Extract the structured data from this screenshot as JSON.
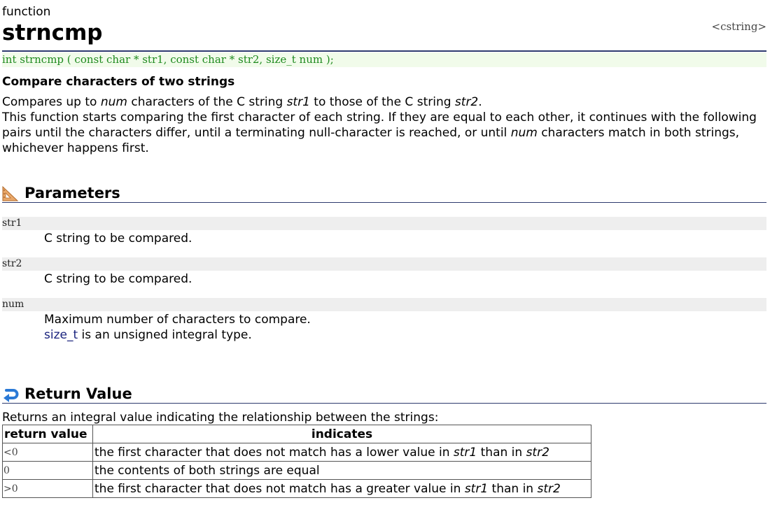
{
  "doc": {
    "kind": "function",
    "title": "strncmp",
    "header_tag": "<cstring>",
    "prototype": "int strncmp ( const char * str1, const char * str2, size_t num );",
    "subtitle": "Compare characters of two strings",
    "description": {
      "p1": {
        "a": "Compares up to ",
        "num": "num",
        "b": " characters of the C string ",
        "str1": "str1",
        "c": " to those of the C string ",
        "str2": "str2",
        "d": "."
      },
      "p2": {
        "a": "This function starts comparing the first character of each string. If they are equal to each other, it continues with the following pairs until the characters differ, until a terminating null-character is reached, or until ",
        "num": "num",
        "b": " characters match in both strings, whichever happens first."
      }
    }
  },
  "parameters": {
    "heading": "Parameters",
    "icon": "triangle-ruler-icon",
    "items": [
      {
        "name": "str1",
        "desc": "C string to be compared."
      },
      {
        "name": "str2",
        "desc": "C string to be compared."
      },
      {
        "name": "num",
        "desc": "Maximum number of characters to compare.",
        "extra_link": "size_t",
        "extra_text": " is an unsigned integral type."
      }
    ]
  },
  "return_value": {
    "heading": "Return Value",
    "icon": "return-arrow-icon",
    "intro": "Returns an integral value indicating the relationship between the strings:",
    "table": {
      "headers": [
        "return value",
        "indicates"
      ],
      "rows": [
        {
          "value": "<0",
          "t1": "the first character that does not match has a lower value in ",
          "em1": "str1",
          "t2": " than in ",
          "em2": "str2"
        },
        {
          "value": "0",
          "t1": "the contents of both strings are equal",
          "em1": "",
          "t2": "",
          "em2": ""
        },
        {
          "value": ">0",
          "t1": "the first character that does not match has a greater value in ",
          "em1": "str1",
          "t2": " than in ",
          "em2": "str2"
        }
      ]
    }
  },
  "colors": {
    "rule": "#2d3a6e",
    "prototype_bg": "#f1fbea",
    "prototype_text": "#1e8a1e",
    "param_bg": "#eeeeee",
    "link": "#1a237e"
  }
}
